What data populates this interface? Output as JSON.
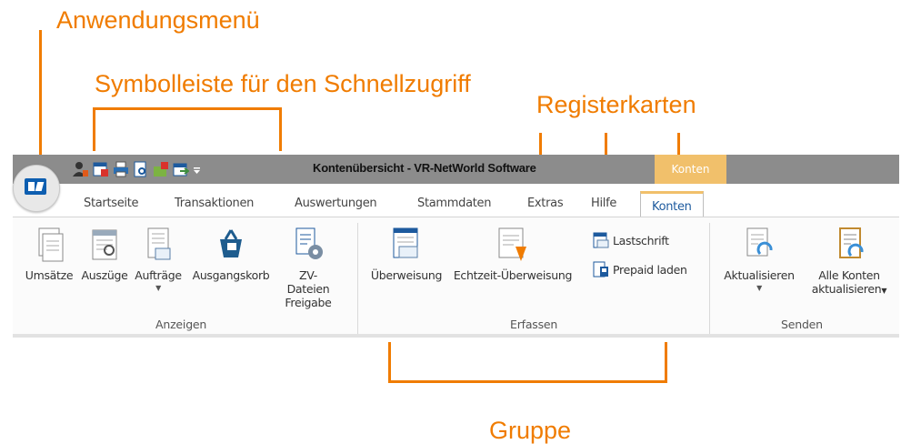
{
  "annotations": {
    "app_menu": "Anwendungsmenü",
    "quick_access": "Symbolleiste für den Schnellzugriff",
    "tabs": "Registerkarten",
    "group": "Gruppe"
  },
  "window": {
    "title": "Kontenübersicht - VR-NetWorld Software",
    "context_header": "Konten"
  },
  "quick_access_icons": [
    "user-icon",
    "calendar-icon",
    "print-icon",
    "preview-icon",
    "mail-icon",
    "export-icon",
    "qat-dropdown-icon"
  ],
  "tabs": [
    {
      "label": "Startseite"
    },
    {
      "label": "Transaktionen"
    },
    {
      "label": "Auswertungen"
    },
    {
      "label": "Stammdaten"
    },
    {
      "label": "Extras"
    },
    {
      "label": "Hilfe"
    },
    {
      "label": "Konten",
      "active": true
    }
  ],
  "groups": {
    "anzeigen": {
      "label": "Anzeigen",
      "buttons": [
        "Umsätze",
        "Auszüge",
        "Aufträge",
        "Ausgangskorb",
        "ZV-Dateien",
        "Freigabe"
      ]
    },
    "erfassen": {
      "label": "Erfassen",
      "buttons": [
        "Überweisung",
        "Echtzeit-Überweisung"
      ],
      "small_buttons": [
        "Lastschrift",
        "Prepaid laden"
      ]
    },
    "senden": {
      "label": "Senden",
      "buttons": [
        "Aktualisieren",
        "Alle Konten",
        "aktualisieren"
      ]
    }
  },
  "colors": {
    "annotation": "#f07c00",
    "titlebar": "#8c8c8c",
    "context_tab": "#f1c06b",
    "active_tab_text": "#1d5a9e"
  }
}
